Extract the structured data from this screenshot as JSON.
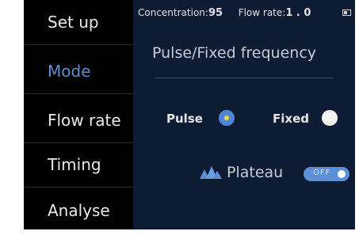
{
  "sidebar": {
    "items": [
      {
        "label": "Set up"
      },
      {
        "label": "Mode"
      },
      {
        "label": "Flow rate"
      },
      {
        "label": "Timing"
      },
      {
        "label": "Analyse"
      }
    ],
    "active_index": 1
  },
  "status": {
    "concentration_label": "Concentration:",
    "concentration_value": "95",
    "flow_label": "Flow rate:",
    "flow_value": "1 . 0",
    "battery_icon": "battery-icon"
  },
  "main": {
    "title": "Pulse/Fixed frequency",
    "options": [
      {
        "label": "Pulse",
        "selected": true
      },
      {
        "label": "Fixed",
        "selected": false
      }
    ],
    "plateau": {
      "icon": "mountain-icon",
      "label": "Plateau",
      "toggle_text": "OFF",
      "enabled": false
    }
  },
  "colors": {
    "screen_bg": "#000000",
    "panel_bg": "#0d1b33",
    "accent": "#5b8fd8",
    "active_menu": "#5a8fd0",
    "radio_dot": "#d8e24a"
  }
}
